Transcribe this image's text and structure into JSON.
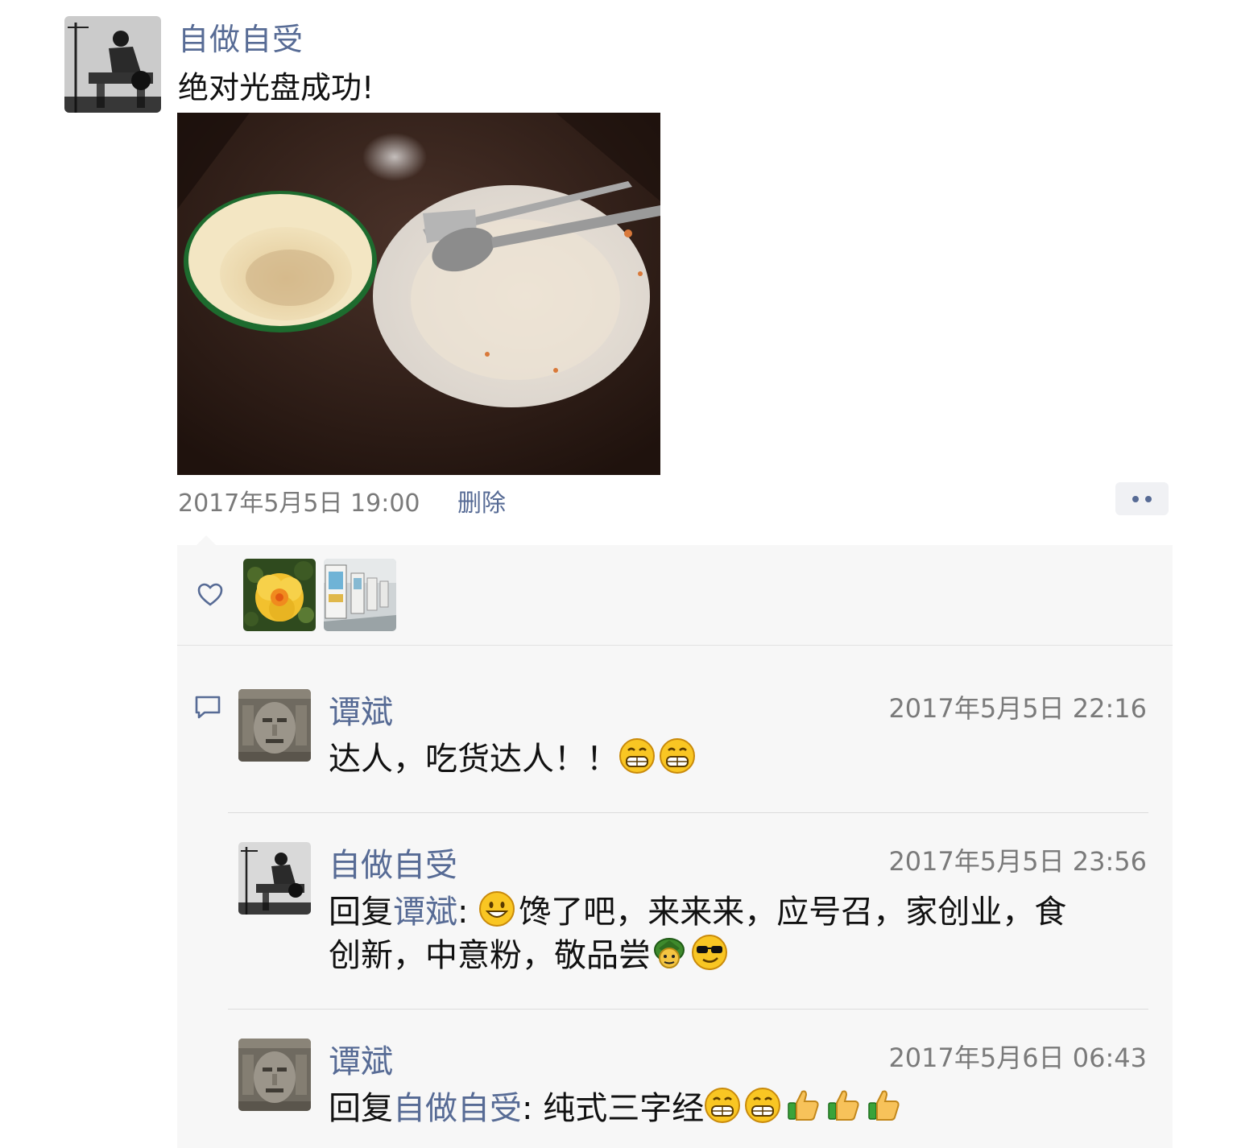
{
  "post": {
    "author": "自做自受",
    "text": "绝对光盘成功!",
    "time": "2017年5月5日 19:00",
    "delete_label": "删除"
  },
  "likes": {
    "avatars": [
      "flower-avatar",
      "corridor-avatar"
    ]
  },
  "comments": [
    {
      "author": "谭斌",
      "time": "2017年5月5日 22:16",
      "text": "达人，吃货达人！！",
      "emojis": [
        "grin",
        "grin"
      ]
    },
    {
      "author": "自做自受",
      "time": "2017年5月5日 23:56",
      "reply_prefix": "回复",
      "reply_to": "谭斌",
      "text_part1": "馋了吧，来来来，应号召，家创业，食",
      "text_part2": "创新，中意粉，敬品尝",
      "emojis_lead": [
        "smile"
      ],
      "emojis_tail": [
        "turtle",
        "cool"
      ]
    },
    {
      "author": "谭斌",
      "time": "2017年5月6日 06:43",
      "reply_prefix": "回复",
      "reply_to": "自做自受",
      "text": "纯式三字经",
      "emojis": [
        "grin",
        "grin",
        "thumbs-up",
        "thumbs-up",
        "thumbs-up"
      ]
    }
  ],
  "colors": {
    "link": "#576b95",
    "meta": "#7a7a7a",
    "panel": "#f7f7f7"
  }
}
